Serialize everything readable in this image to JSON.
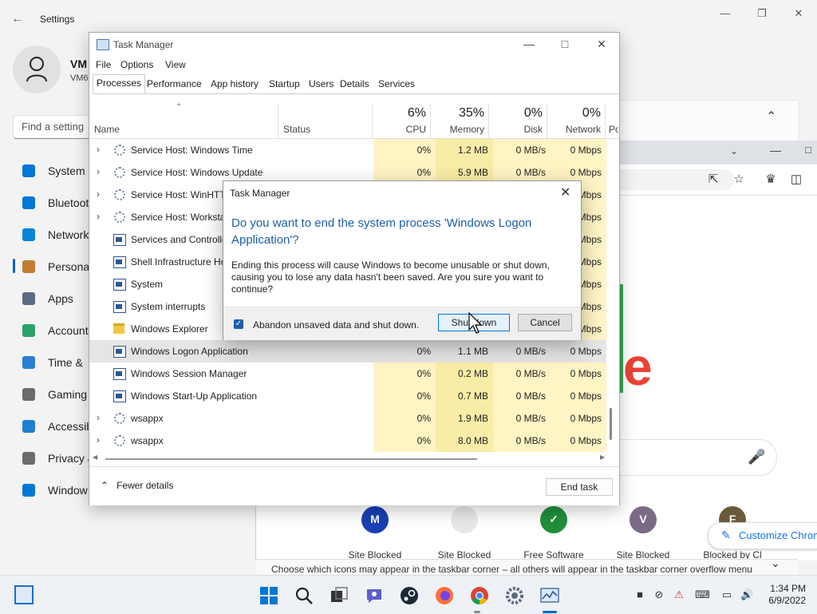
{
  "settings": {
    "title": "Settings",
    "user_name": "VM",
    "user_sub": "VM6",
    "search_placeholder": "Find a setting",
    "nav": [
      {
        "label": "System",
        "icon": "display-icon",
        "color": "#0078d4"
      },
      {
        "label": "Bluetooth",
        "icon": "bluetooth-icon",
        "color": "#0078d4"
      },
      {
        "label": "Network",
        "icon": "wifi-icon",
        "color": "#0a84d8"
      },
      {
        "label": "Personal",
        "icon": "brush-icon",
        "color": "#c27c30"
      },
      {
        "label": "Apps",
        "icon": "apps-icon",
        "color": "#5a6b82"
      },
      {
        "label": "Account",
        "icon": "person-icon",
        "color": "#2aa16b"
      },
      {
        "label": "Time &",
        "icon": "clock-icon",
        "color": "#2a7fd4"
      },
      {
        "label": "Gaming",
        "icon": "gamepad-icon",
        "color": "#6b6b6b"
      },
      {
        "label": "Accessib",
        "icon": "accessibility-icon",
        "color": "#1f7fd1"
      },
      {
        "label": "Privacy &",
        "icon": "shield-icon",
        "color": "#6b6b6b"
      },
      {
        "label": "Window",
        "icon": "update-icon",
        "color": "#0078d4"
      }
    ],
    "status_strip": "Choose which icons may appear in the taskbar corner – all others will appear in the taskbar corner overflow menu"
  },
  "chrome": {
    "logo_fragment": "le",
    "tiles": [
      {
        "letter": "M",
        "label": "Site Blocked",
        "bg": "#1a3fb5",
        "fg": "#ffffff"
      },
      {
        "letter": "",
        "label": "Site Blocked",
        "bg": "#e8e8e8",
        "fg": "#333333"
      },
      {
        "letter": "✓",
        "label": "Free Software",
        "bg": "#1f8f3a",
        "fg": "#ffffff"
      },
      {
        "letter": "V",
        "label": "Site Blocked",
        "bg": "#7a6a86",
        "fg": "#ffffff"
      },
      {
        "letter": "F",
        "label": "Blocked by Cl",
        "bg": "#6b5a3a",
        "fg": "#ffffff"
      }
    ],
    "customize": "Customize Chrome"
  },
  "taskmgr": {
    "title": "Task Manager",
    "menu": [
      "File",
      "Options",
      "View"
    ],
    "tabs": [
      "Processes",
      "Performance",
      "App history",
      "Startup",
      "Users",
      "Details",
      "Services"
    ],
    "columns": {
      "name": "Name",
      "status": "Status",
      "cpu": {
        "pct": "6%",
        "label": "CPU"
      },
      "memory": {
        "pct": "35%",
        "label": "Memory"
      },
      "disk": {
        "pct": "0%",
        "label": "Disk"
      },
      "network": {
        "pct": "0%",
        "label": "Network"
      },
      "power": "Po"
    },
    "rows": [
      {
        "name": "Service Host: Windows Time",
        "icon": "gear",
        "expand": true,
        "cpu": "0%",
        "mem": "1.2 MB",
        "disk": "0 MB/s",
        "net": "0 Mbps",
        "selected": false
      },
      {
        "name": "Service Host: Windows Update",
        "icon": "gear",
        "expand": true,
        "cpu": "0%",
        "mem": "5.9 MB",
        "disk": "0 MB/s",
        "net": "0 Mbps",
        "selected": false
      },
      {
        "name": "Service Host: WinHTTP",
        "icon": "gear",
        "expand": true,
        "cpu": "",
        "mem": "",
        "disk": "",
        "net": "Mbps",
        "selected": false
      },
      {
        "name": "Service Host: Workstat",
        "icon": "gear",
        "expand": true,
        "cpu": "",
        "mem": "",
        "disk": "",
        "net": "Mbps",
        "selected": false
      },
      {
        "name": "Services and Controlle",
        "icon": "win",
        "expand": false,
        "cpu": "",
        "mem": "",
        "disk": "",
        "net": "Mbps",
        "selected": false
      },
      {
        "name": "Shell Infrastructure Ho",
        "icon": "win",
        "expand": false,
        "cpu": "",
        "mem": "",
        "disk": "",
        "net": "Mbps",
        "selected": false
      },
      {
        "name": "System",
        "icon": "win",
        "expand": false,
        "cpu": "",
        "mem": "",
        "disk": "",
        "net": "Mbps",
        "selected": false
      },
      {
        "name": "System interrupts",
        "icon": "win",
        "expand": false,
        "cpu": "",
        "mem": "",
        "disk": "",
        "net": "Mbps",
        "selected": false
      },
      {
        "name": "Windows Explorer",
        "icon": "fold",
        "expand": false,
        "cpu": "",
        "mem": "",
        "disk": "",
        "net": "Mbps",
        "selected": false
      },
      {
        "name": "Windows Logon Application",
        "icon": "win",
        "expand": false,
        "cpu": "0%",
        "mem": "1.1 MB",
        "disk": "0 MB/s",
        "net": "0 Mbps",
        "selected": true
      },
      {
        "name": "Windows Session Manager",
        "icon": "win",
        "expand": false,
        "cpu": "0%",
        "mem": "0.2 MB",
        "disk": "0 MB/s",
        "net": "0 Mbps",
        "selected": false
      },
      {
        "name": "Windows Start-Up Application",
        "icon": "win",
        "expand": false,
        "cpu": "0%",
        "mem": "0.7 MB",
        "disk": "0 MB/s",
        "net": "0 Mbps",
        "selected": false
      },
      {
        "name": "wsappx",
        "icon": "gear",
        "expand": true,
        "cpu": "0%",
        "mem": "1.9 MB",
        "disk": "0 MB/s",
        "net": "0 Mbps",
        "selected": false
      },
      {
        "name": "wsappx",
        "icon": "gear",
        "expand": true,
        "cpu": "0%",
        "mem": "8.0 MB",
        "disk": "0 MB/s",
        "net": "0 Mbps",
        "selected": false
      }
    ],
    "fewer_details": "Fewer details",
    "end_task": "End task"
  },
  "dialog": {
    "title": "Task Manager",
    "heading": "Do you want to end the system process 'Windows Logon Application'?",
    "body": "Ending this process will cause Windows to become unusable or shut down, causing you to lose any data hasn't been saved. Are you sure you want to continue?",
    "checkbox_label": "Abandon unsaved data and shut down.",
    "checkbox_checked": true,
    "shutdown_label": "Shut down",
    "cancel_label": "Cancel"
  },
  "taskbar": {
    "time": "1:34 PM",
    "date": "6/9/2022"
  }
}
